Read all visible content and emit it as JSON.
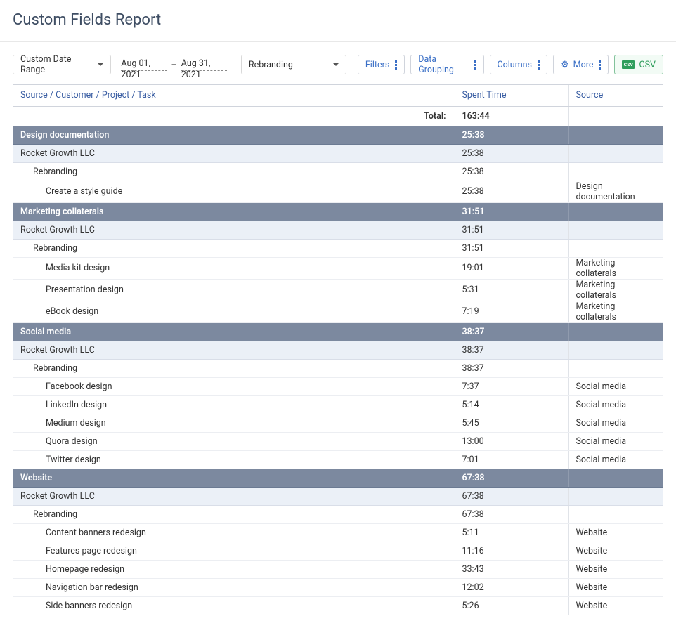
{
  "title": "Custom Fields Report",
  "toolbar": {
    "date_mode": "Custom Date Range",
    "date_from": "Aug 01, 2021",
    "date_sep": "–",
    "date_to": "Aug 31, 2021",
    "project_filter": "Rebranding",
    "filters": "Filters",
    "grouping": "Data Grouping",
    "columns": "Columns",
    "more": "More",
    "csv_badge": "CSV",
    "csv": "CSV"
  },
  "headers": {
    "path": "Source / Customer / Project / Task",
    "time": "Spent Time",
    "source": "Source"
  },
  "total": {
    "label": "Total:",
    "time": "163:44"
  },
  "groups": [
    {
      "name": "Design documentation",
      "time": "25:38",
      "customers": [
        {
          "name": "Rocket Growth LLC",
          "time": "25:38",
          "projects": [
            {
              "name": "Rebranding",
              "time": "25:38",
              "tasks": [
                {
                  "name": "Create a style guide",
                  "time": "25:38",
                  "source": "Design documentation"
                }
              ]
            }
          ]
        }
      ]
    },
    {
      "name": "Marketing collaterals",
      "time": "31:51",
      "customers": [
        {
          "name": "Rocket Growth LLC",
          "time": "31:51",
          "projects": [
            {
              "name": "Rebranding",
              "time": "31:51",
              "tasks": [
                {
                  "name": "Media kit design",
                  "time": "19:01",
                  "source": "Marketing collaterals"
                },
                {
                  "name": "Presentation design",
                  "time": "5:31",
                  "source": "Marketing collaterals"
                },
                {
                  "name": "eBook design",
                  "time": "7:19",
                  "source": "Marketing collaterals"
                }
              ]
            }
          ]
        }
      ]
    },
    {
      "name": "Social media",
      "time": "38:37",
      "customers": [
        {
          "name": "Rocket Growth LLC",
          "time": "38:37",
          "projects": [
            {
              "name": "Rebranding",
              "time": "38:37",
              "tasks": [
                {
                  "name": "Facebook design",
                  "time": "7:37",
                  "source": "Social media"
                },
                {
                  "name": "LinkedIn design",
                  "time": "5:14",
                  "source": "Social media"
                },
                {
                  "name": "Medium design",
                  "time": "5:45",
                  "source": "Social media"
                },
                {
                  "name": "Quora design",
                  "time": "13:00",
                  "source": "Social media"
                },
                {
                  "name": "Twitter design",
                  "time": "7:01",
                  "source": "Social media"
                }
              ]
            }
          ]
        }
      ]
    },
    {
      "name": "Website",
      "time": "67:38",
      "customers": [
        {
          "name": "Rocket Growth LLC",
          "time": "67:38",
          "projects": [
            {
              "name": "Rebranding",
              "time": "67:38",
              "tasks": [
                {
                  "name": "Content banners redesign",
                  "time": "5:11",
                  "source": "Website"
                },
                {
                  "name": "Features page redesign",
                  "time": "11:16",
                  "source": "Website"
                },
                {
                  "name": "Homepage redesign",
                  "time": "33:43",
                  "source": "Website"
                },
                {
                  "name": "Navigation bar redesign",
                  "time": "12:02",
                  "source": "Website"
                },
                {
                  "name": "Side banners redesign",
                  "time": "5:26",
                  "source": "Website"
                }
              ]
            }
          ]
        }
      ]
    }
  ]
}
